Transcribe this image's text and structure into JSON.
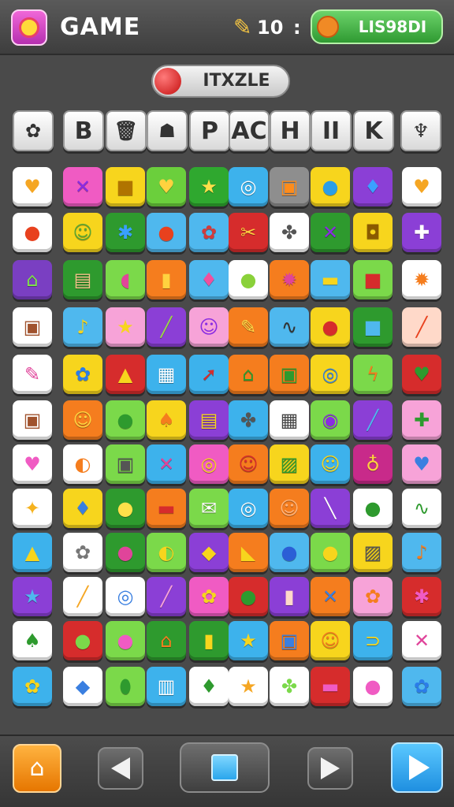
{
  "header": {
    "title": "GAME",
    "score": "10",
    "separator": ":",
    "badge_label": "LIS98DI",
    "score_icon": "feather-icon",
    "badge_icon": "fruit-icon"
  },
  "logo": {
    "text": "ITXZLE",
    "icon": "red-ball-icon"
  },
  "letter_row": [
    {
      "kind": "icon",
      "glyph": "✿",
      "name": "flower-icon"
    },
    {
      "kind": "text",
      "text": "B"
    },
    {
      "kind": "icon",
      "glyph": "🗑",
      "name": "bin-icon"
    },
    {
      "kind": "icon",
      "glyph": "☗",
      "name": "cat-icon"
    },
    {
      "kind": "text",
      "text": "P"
    },
    {
      "kind": "text",
      "text": "AC"
    },
    {
      "kind": "text",
      "text": "H"
    },
    {
      "kind": "text",
      "text": "II"
    },
    {
      "kind": "text",
      "text": "K"
    },
    {
      "kind": "icon",
      "glyph": "♆",
      "name": "spoon-icon"
    }
  ],
  "grid": {
    "rows": [
      [
        {
          "bg": "#ffffff",
          "glyph": "♥",
          "color": "#f5a623",
          "name": "heart-icon"
        },
        {
          "bg": "#f05bc3",
          "glyph": "✕",
          "color": "#8a2be2",
          "name": "cross-icon"
        },
        {
          "bg": "#f7d51d",
          "glyph": "■",
          "color": "#b07400",
          "name": "box-icon"
        },
        {
          "bg": "#6bcf3c",
          "glyph": "♥",
          "color": "#ffd23f",
          "name": "heart-icon"
        },
        {
          "bg": "#2fa82f",
          "glyph": "★",
          "color": "#ffe04a",
          "name": "star-icon"
        },
        {
          "bg": "#3db2ec",
          "glyph": "◎",
          "color": "#ffffff",
          "name": "target-icon"
        },
        {
          "bg": "#8e8e8e",
          "glyph": "▣",
          "color": "#ff8c1a",
          "name": "car-icon"
        },
        {
          "bg": "#f7d51d",
          "glyph": "●",
          "color": "#2b9ee6",
          "name": "circle-icon"
        },
        {
          "bg": "#8b3fd6",
          "glyph": "♦",
          "color": "#3aa0ff",
          "name": "gem-icon"
        },
        {
          "bg": "#ffffff",
          "glyph": "♥",
          "color": "#f5a623",
          "name": "heart-icon"
        }
      ],
      [
        {
          "bg": "#ffffff",
          "glyph": "●",
          "color": "#e8411e",
          "name": "dot-icon"
        },
        {
          "bg": "#f7d51d",
          "glyph": "☺",
          "color": "#5aa832",
          "name": "face-icon"
        },
        {
          "bg": "#2e9a2e",
          "glyph": "✱",
          "color": "#3aa0ff",
          "name": "spark-icon"
        },
        {
          "bg": "#4fb8ee",
          "glyph": "●",
          "color": "#e8411e",
          "name": "dot-icon"
        },
        {
          "bg": "#4fb8ee",
          "glyph": "✿",
          "color": "#d23b3b",
          "name": "flower-icon"
        },
        {
          "bg": "#d62c2c",
          "glyph": "✂",
          "color": "#ffd23f",
          "name": "scissors-icon"
        },
        {
          "bg": "#ffffff",
          "glyph": "✤",
          "color": "#555555",
          "name": "cluster-icon"
        },
        {
          "bg": "#2e9a2e",
          "glyph": "✕",
          "color": "#8a2be2",
          "name": "cross-icon"
        },
        {
          "bg": "#f7d51d",
          "glyph": "◘",
          "color": "#8a5a00",
          "name": "frame-icon"
        },
        {
          "bg": "#8b3fd6",
          "glyph": "✚",
          "color": "#ffffff",
          "name": "plus-icon"
        }
      ],
      [
        {
          "bg": "#7a3fc2",
          "glyph": "⌂",
          "color": "#7de04a",
          "name": "house-icon"
        },
        {
          "bg": "#2e9a2e",
          "glyph": "▤",
          "color": "#f4c28a",
          "name": "list-icon"
        },
        {
          "bg": "#7bd94a",
          "glyph": "◖",
          "color": "#e0449a",
          "name": "cup-icon"
        },
        {
          "bg": "#f57d1e",
          "glyph": "▮",
          "color": "#ffd23f",
          "name": "bar-icon"
        },
        {
          "bg": "#4fb8ee",
          "glyph": "♦",
          "color": "#f0509e",
          "name": "drop-icon"
        },
        {
          "bg": "#ffffff",
          "glyph": "●",
          "color": "#8ad13a",
          "name": "bubble-icon"
        },
        {
          "bg": "#f57d1e",
          "glyph": "✹",
          "color": "#e0449a",
          "name": "burst-icon"
        },
        {
          "bg": "#4fb8ee",
          "glyph": "▬",
          "color": "#f7d51d",
          "name": "card-icon"
        },
        {
          "bg": "#7bd94a",
          "glyph": "■",
          "color": "#d62c2c",
          "name": "cube-icon"
        },
        {
          "bg": "#ffffff",
          "glyph": "✹",
          "color": "#f57d1e",
          "name": "sun-icon"
        }
      ],
      [
        {
          "bg": "#ffffff",
          "glyph": "▣",
          "color": "#a0522d",
          "name": "box-icon"
        },
        {
          "bg": "#4fb8ee",
          "glyph": "♪",
          "color": "#f7d51d",
          "name": "wand-icon"
        },
        {
          "bg": "#f7a3d8",
          "glyph": "★",
          "color": "#f7d51d",
          "name": "star-icon"
        },
        {
          "bg": "#8b3fd6",
          "glyph": "╱",
          "color": "#9bd64a",
          "name": "pencil-icon"
        },
        {
          "bg": "#f7a3d8",
          "glyph": "☺",
          "color": "#8a2be2",
          "name": "face-icon"
        },
        {
          "bg": "#f57d1e",
          "glyph": "✎",
          "color": "#ffe04a",
          "name": "pencil-icon"
        },
        {
          "bg": "#4fb8ee",
          "glyph": "∿",
          "color": "#333333",
          "name": "wave-icon"
        },
        {
          "bg": "#f7d51d",
          "glyph": "●",
          "color": "#d62c2c",
          "name": "apple-icon"
        },
        {
          "bg": "#2e9a2e",
          "glyph": "■",
          "color": "#4fb8ee",
          "name": "square-icon"
        },
        {
          "bg": "#ffd9c9",
          "glyph": "╱",
          "color": "#e8411e",
          "name": "crayon-icon"
        }
      ],
      [
        {
          "bg": "#ffffff",
          "glyph": "✎",
          "color": "#e0449a",
          "name": "brush-icon"
        },
        {
          "bg": "#f7d51d",
          "glyph": "✿",
          "color": "#2b7de9",
          "name": "flower-icon"
        },
        {
          "bg": "#d62c2c",
          "glyph": "▲",
          "color": "#f7d51d",
          "name": "hat-icon"
        },
        {
          "bg": "#3db2ec",
          "glyph": "▦",
          "color": "#ffffff",
          "name": "board-icon"
        },
        {
          "bg": "#3db2ec",
          "glyph": "➚",
          "color": "#d62c2c",
          "name": "arrow-icon"
        },
        {
          "bg": "#f57d1e",
          "glyph": "⌂",
          "color": "#2e9a2e",
          "name": "house-icon"
        },
        {
          "bg": "#f57d1e",
          "glyph": "▣",
          "color": "#2e9a2e",
          "name": "frame-icon"
        },
        {
          "bg": "#f7d51d",
          "glyph": "◎",
          "color": "#2b7de9",
          "name": "ring-icon"
        },
        {
          "bg": "#7bd94a",
          "glyph": "ϟ",
          "color": "#f57d1e",
          "name": "bolt-icon"
        },
        {
          "bg": "#d62c2c",
          "glyph": "♥",
          "color": "#2e9a2e",
          "name": "heart-icon"
        }
      ],
      [
        {
          "bg": "#ffffff",
          "glyph": "▣",
          "color": "#a0522d",
          "name": "box-icon"
        },
        {
          "bg": "#f57d1e",
          "glyph": "☺",
          "color": "#ffd23f",
          "name": "face-icon"
        },
        {
          "bg": "#7bd94a",
          "glyph": "●",
          "color": "#2e9a2e",
          "name": "bubble-icon"
        },
        {
          "bg": "#f7d51d",
          "glyph": "♠",
          "color": "#f57d1e",
          "name": "leaf-icon"
        },
        {
          "bg": "#8b3fd6",
          "glyph": "▤",
          "color": "#f7d51d",
          "name": "stack-icon"
        },
        {
          "bg": "#3db2ec",
          "glyph": "✤",
          "color": "#555555",
          "name": "gear-icon"
        },
        {
          "bg": "#ffffff",
          "glyph": "▦",
          "color": "#444444",
          "name": "grid-icon"
        },
        {
          "bg": "#7bd94a",
          "glyph": "◉",
          "color": "#8a2be2",
          "name": "orb-icon"
        },
        {
          "bg": "#8b3fd6",
          "glyph": "╱",
          "color": "#4fb8ee",
          "name": "pen-icon"
        },
        {
          "bg": "#f7a3d8",
          "glyph": "✚",
          "color": "#2e9a2e",
          "name": "plus-icon"
        }
      ],
      [
        {
          "bg": "#ffffff",
          "glyph": "♥",
          "color": "#f05bc3",
          "name": "heart-icon"
        },
        {
          "bg": "#ffffff",
          "glyph": "◐",
          "color": "#f57d1e",
          "name": "swirl-icon"
        },
        {
          "bg": "#7bd94a",
          "glyph": "▣",
          "color": "#555555",
          "name": "crate-icon"
        },
        {
          "bg": "#3db2ec",
          "glyph": "✕",
          "color": "#e0449a",
          "name": "cross-icon"
        },
        {
          "bg": "#f05bc3",
          "glyph": "◎",
          "color": "#f7d51d",
          "name": "ring-icon"
        },
        {
          "bg": "#f57d1e",
          "glyph": "☺",
          "color": "#d62c2c",
          "name": "face-icon"
        },
        {
          "bg": "#f7d51d",
          "glyph": "▨",
          "color": "#2e9a2e",
          "name": "pattern-icon"
        },
        {
          "bg": "#3db2ec",
          "glyph": "☺",
          "color": "#f7d51d",
          "name": "face-icon"
        },
        {
          "bg": "#c82a8a",
          "glyph": "♁",
          "color": "#ffd23f",
          "name": "bell-icon"
        },
        {
          "bg": "#f7a3d8",
          "glyph": "♥",
          "color": "#3a7fe0",
          "name": "heart-icon"
        }
      ],
      [
        {
          "bg": "#ffffff",
          "glyph": "✦",
          "color": "#f5b21e",
          "name": "candy-icon"
        },
        {
          "bg": "#f7d51d",
          "glyph": "♦",
          "color": "#3a7fe0",
          "name": "crystal-icon"
        },
        {
          "bg": "#2e9a2e",
          "glyph": "●",
          "color": "#ffe04a",
          "name": "apple-icon"
        },
        {
          "bg": "#f57d1e",
          "glyph": "▬",
          "color": "#d62c2c",
          "name": "car-icon"
        },
        {
          "bg": "#7bd94a",
          "glyph": "✉",
          "color": "#ffffff",
          "name": "mail-icon"
        },
        {
          "bg": "#3db2ec",
          "glyph": "◎",
          "color": "#ffffff",
          "name": "target-icon"
        },
        {
          "bg": "#f57d1e",
          "glyph": "☺",
          "color": "#ffb37a",
          "name": "pumpkin-icon"
        },
        {
          "bg": "#8b3fd6",
          "glyph": "╲",
          "color": "#ffffff",
          "name": "tool-icon"
        },
        {
          "bg": "#ffffff",
          "glyph": "●",
          "color": "#2e9a2e",
          "name": "apple-icon"
        },
        {
          "bg": "#ffffff",
          "glyph": "∿",
          "color": "#2e9a2e",
          "name": "wave-icon"
        }
      ],
      [
        {
          "bg": "#3db2ec",
          "glyph": "▲",
          "color": "#f7d51d",
          "name": "mountain-icon"
        },
        {
          "bg": "#ffffff",
          "glyph": "✿",
          "color": "#777777",
          "name": "gear-icon"
        },
        {
          "bg": "#2e9a2e",
          "glyph": "●",
          "color": "#e0449a",
          "name": "apple-icon"
        },
        {
          "bg": "#7bd94a",
          "glyph": "◐",
          "color": "#f7d51d",
          "name": "moon-icon"
        },
        {
          "bg": "#8b3fd6",
          "glyph": "◆",
          "color": "#f7d51d",
          "name": "gem-icon"
        },
        {
          "bg": "#f57d1e",
          "glyph": "◣",
          "color": "#f7d51d",
          "name": "flag-icon"
        },
        {
          "bg": "#4fb8ee",
          "glyph": "●",
          "color": "#2b5fd6",
          "name": "ball-icon"
        },
        {
          "bg": "#7bd94a",
          "glyph": "●",
          "color": "#f7d51d",
          "name": "bubble-icon"
        },
        {
          "bg": "#f7d51d",
          "glyph": "▨",
          "color": "#555555",
          "name": "note-icon"
        },
        {
          "bg": "#4fb8ee",
          "glyph": "♪",
          "color": "#f57d1e",
          "name": "horn-icon"
        }
      ],
      [
        {
          "bg": "#8b3fd6",
          "glyph": "★",
          "color": "#4fb8ee",
          "name": "star-icon"
        },
        {
          "bg": "#ffffff",
          "glyph": "╱",
          "color": "#f5a623",
          "name": "pencil-icon"
        },
        {
          "bg": "#ffffff",
          "glyph": "◎",
          "color": "#3a7fe0",
          "name": "spiral-icon"
        },
        {
          "bg": "#8b3fd6",
          "glyph": "╱",
          "color": "#f7a3d8",
          "name": "brush-icon"
        },
        {
          "bg": "#f05bc3",
          "glyph": "✿",
          "color": "#f7d51d",
          "name": "flower-icon"
        },
        {
          "bg": "#d62c2c",
          "glyph": "●",
          "color": "#2e9a2e",
          "name": "ball-icon"
        },
        {
          "bg": "#8b3fd6",
          "glyph": "▮",
          "color": "#ffd9c9",
          "name": "jar-icon"
        },
        {
          "bg": "#f57d1e",
          "glyph": "✕",
          "color": "#3a7fe0",
          "name": "cross-icon"
        },
        {
          "bg": "#f7a3d8",
          "glyph": "✿",
          "color": "#f57d1e",
          "name": "flower-icon"
        },
        {
          "bg": "#d62c2c",
          "glyph": "✱",
          "color": "#f05bc3",
          "name": "star-icon"
        }
      ],
      [
        {
          "bg": "#ffffff",
          "glyph": "♠",
          "color": "#2e9a2e",
          "name": "leaf-icon"
        },
        {
          "bg": "#d62c2c",
          "glyph": "●",
          "color": "#7bd94a",
          "name": "apple-icon"
        },
        {
          "bg": "#7bd94a",
          "glyph": "●",
          "color": "#f05bc3",
          "name": "apple-icon"
        },
        {
          "bg": "#2e9a2e",
          "glyph": "⌂",
          "color": "#f57d1e",
          "name": "house-icon"
        },
        {
          "bg": "#2e9a2e",
          "glyph": "▮",
          "color": "#f7d51d",
          "name": "cup-icon"
        },
        {
          "bg": "#3db2ec",
          "glyph": "★",
          "color": "#f7d51d",
          "name": "star-icon"
        },
        {
          "bg": "#f57d1e",
          "glyph": "▣",
          "color": "#3a7fe0",
          "name": "screen-icon"
        },
        {
          "bg": "#f7d51d",
          "glyph": "☺",
          "color": "#f57d1e",
          "name": "face-icon"
        },
        {
          "bg": "#3db2ec",
          "glyph": "⊃",
          "color": "#f7d51d",
          "name": "hook-icon"
        },
        {
          "bg": "#ffffff",
          "glyph": "✕",
          "color": "#e0449a",
          "name": "cross-icon"
        }
      ],
      [
        {
          "bg": "#3db2ec",
          "glyph": "✿",
          "color": "#f7d51d",
          "name": "flower-icon"
        },
        {
          "bg": "#ffffff",
          "glyph": "◆",
          "color": "#3a7fe0",
          "name": "diamond-icon"
        },
        {
          "bg": "#7bd94a",
          "glyph": "⬮",
          "color": "#2e9a2e",
          "name": "capsule-icon"
        },
        {
          "bg": "#3db2ec",
          "glyph": "▥",
          "color": "#ffffff",
          "name": "chart-icon"
        },
        {
          "bg": "#ffffff",
          "glyph": "♦",
          "color": "#2e9a2e",
          "name": "leaf-icon"
        },
        {
          "bg": "#ffffff",
          "glyph": "★",
          "color": "#f5a623",
          "name": "star-icon"
        },
        {
          "bg": "#ffffff",
          "glyph": "✤",
          "color": "#7bd94a",
          "name": "clover-icon"
        },
        {
          "bg": "#d62c2c",
          "glyph": "▬",
          "color": "#f05bc3",
          "name": "bus-icon"
        },
        {
          "bg": "#ffffff",
          "glyph": "●",
          "color": "#f05bc3",
          "name": "ball-icon"
        },
        {
          "bg": "#4fb8ee",
          "glyph": "✿",
          "color": "#2b7de9",
          "name": "gear-icon"
        }
      ]
    ]
  },
  "footer": {
    "home": "home-icon",
    "prev": "previous-icon",
    "stop": "stop-icon",
    "next": "next-icon",
    "play": "play-icon"
  }
}
